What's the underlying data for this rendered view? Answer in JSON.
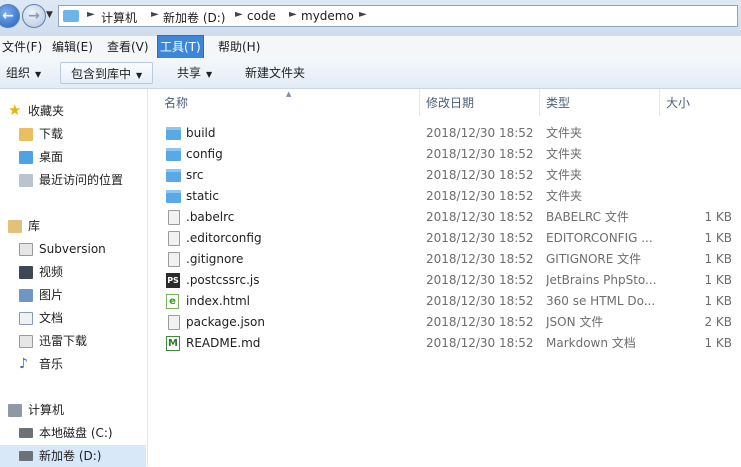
{
  "address": {
    "crumbs": [
      "计算机",
      "新加卷 (D:)",
      "code",
      "mydemo"
    ]
  },
  "menu": [
    {
      "label": "文件(F)"
    },
    {
      "label": "编辑(E)"
    },
    {
      "label": "查看(V)"
    },
    {
      "label": "工具(T)",
      "active": true
    },
    {
      "label": "帮助(H)"
    }
  ],
  "toolbar": {
    "organize": "组织",
    "include_library": "包含到库中",
    "share": "共享",
    "new_folder": "新建文件夹"
  },
  "nav": {
    "favorites": "收藏夹",
    "downloads": "下载",
    "desktop": "桌面",
    "recent": "最近访问的位置",
    "libraries": "库",
    "subversion": "Subversion",
    "videos": "视频",
    "pictures": "图片",
    "documents": "文档",
    "thunder": "迅雷下载",
    "music": "音乐",
    "computer": "计算机",
    "drive_c": "本地磁盘 (C:)",
    "drive_d": "新加卷 (D:)"
  },
  "columns": {
    "name": "名称",
    "date": "修改日期",
    "type": "类型",
    "size": "大小"
  },
  "files": [
    {
      "name": "build",
      "date": "2018/12/30 18:52",
      "type": "文件夹",
      "size": "",
      "icon": "folder-icon"
    },
    {
      "name": "config",
      "date": "2018/12/30 18:52",
      "type": "文件夹",
      "size": "",
      "icon": "folder-icon"
    },
    {
      "name": "src",
      "date": "2018/12/30 18:52",
      "type": "文件夹",
      "size": "",
      "icon": "folder-icon"
    },
    {
      "name": "static",
      "date": "2018/12/30 18:52",
      "type": "文件夹",
      "size": "",
      "icon": "folder-icon"
    },
    {
      "name": ".babelrc",
      "date": "2018/12/30 18:52",
      "type": "BABELRC 文件",
      "size": "1 KB",
      "icon": "document-icon"
    },
    {
      "name": ".editorconfig",
      "date": "2018/12/30 18:52",
      "type": "EDITORCONFIG ...",
      "size": "1 KB",
      "icon": "document-icon"
    },
    {
      "name": ".gitignore",
      "date": "2018/12/30 18:52",
      "type": "GITIGNORE 文件",
      "size": "1 KB",
      "icon": "document-icon"
    },
    {
      "name": ".postcssrc.js",
      "date": "2018/12/30 18:52",
      "type": "JetBrains PhpSto...",
      "size": "1 KB",
      "icon": "phpstorm-icon"
    },
    {
      "name": "index.html",
      "date": "2018/12/30 18:52",
      "type": "360 se HTML Do...",
      "size": "1 KB",
      "icon": "html-icon"
    },
    {
      "name": "package.json",
      "date": "2018/12/30 18:52",
      "type": "JSON 文件",
      "size": "2 KB",
      "icon": "document-icon"
    },
    {
      "name": "README.md",
      "date": "2018/12/30 18:52",
      "type": "Markdown 文档",
      "size": "1 KB",
      "icon": "markdown-icon"
    }
  ]
}
